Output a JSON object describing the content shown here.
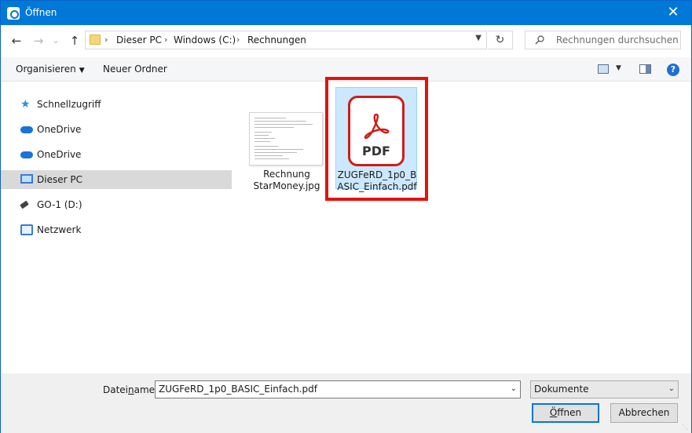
{
  "window": {
    "title": "Öffnen",
    "close_glyph": "✕"
  },
  "navigation": {
    "back_glyph": "←",
    "forward_glyph": "→",
    "recent_glyph": "⌄",
    "up_glyph": "↑",
    "breadcrumbs": [
      "Dieser PC",
      "Windows (C:)",
      "Rechnungen"
    ],
    "crumb_separator": "›",
    "refresh_glyph": "↻",
    "search_placeholder": "Rechnungen durchsuchen"
  },
  "toolbar": {
    "organize_label": "Organisieren",
    "new_folder_label": "Neuer Ordner",
    "help_glyph": "?"
  },
  "sidebar": {
    "items": [
      {
        "label": "Schnellzugriff",
        "icon": "star-icon"
      },
      {
        "label": "OneDrive",
        "icon": "cloud-icon"
      },
      {
        "label": "OneDrive",
        "icon": "cloud-icon"
      },
      {
        "label": "Dieser PC",
        "icon": "computer-icon",
        "selected": true
      },
      {
        "label": "GO-1 (D:)",
        "icon": "usb-drive-icon"
      },
      {
        "label": "Netzwerk",
        "icon": "network-icon"
      }
    ]
  },
  "files": [
    {
      "name_line1": "Rechnung",
      "name_line2": "StarMoney.jpg",
      "type": "image-thumbnail",
      "selected": false
    },
    {
      "name_line1": "ZUGFeRD_1p0_B",
      "name_line2": "ASIC_Einfach.pdf",
      "type": "pdf",
      "icon_text": "PDF",
      "selected": true
    }
  ],
  "bottom": {
    "filename_label_pre": "Datei",
    "filename_label_ul": "n",
    "filename_label_post": "ame:",
    "filename_value": "ZUGFeRD_1p0_BASIC_Einfach.pdf",
    "filetype_value": "Dokumente",
    "open_button_ul": "Ö",
    "open_button_rest": "ffnen",
    "cancel_button": "Abbrechen"
  },
  "colors": {
    "titlebar": "#0078d7",
    "highlight": "#e3120b",
    "selection": "#cce8ff",
    "pdf_red": "#d01c17"
  }
}
